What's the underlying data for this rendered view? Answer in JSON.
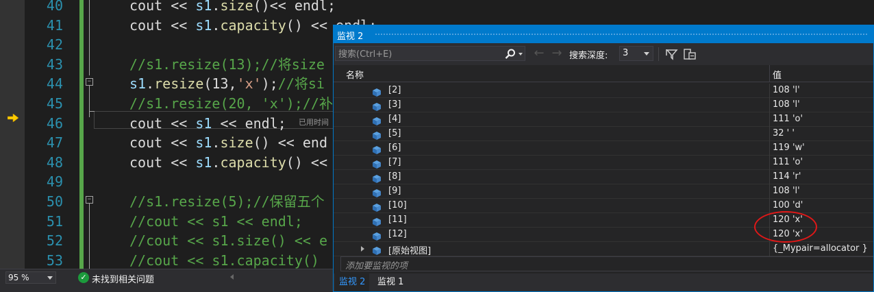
{
  "editor": {
    "lines": [
      {
        "num": "40",
        "segments": [
          {
            "t": "cout << ",
            "c": "p"
          },
          {
            "t": "s1",
            "c": "id"
          },
          {
            "t": ".",
            "c": "p"
          },
          {
            "t": "size",
            "c": "fn"
          },
          {
            "t": "()<< endl;",
            "c": "p"
          }
        ]
      },
      {
        "num": "41",
        "segments": [
          {
            "t": "cout << ",
            "c": "p"
          },
          {
            "t": "s1",
            "c": "id"
          },
          {
            "t": ".",
            "c": "p"
          },
          {
            "t": "capacity",
            "c": "fn"
          },
          {
            "t": "() << endl;",
            "c": "p"
          }
        ]
      },
      {
        "num": "42",
        "segments": []
      },
      {
        "num": "43",
        "segments": [
          {
            "t": "//s1.resize(13);//将size",
            "c": "cm"
          }
        ]
      },
      {
        "num": "44",
        "segments": [
          {
            "t": "s1",
            "c": "id"
          },
          {
            "t": ".",
            "c": "p"
          },
          {
            "t": "resize",
            "c": "fn"
          },
          {
            "t": "(13,",
            "c": "p"
          },
          {
            "t": "'x'",
            "c": "str"
          },
          {
            "t": ");",
            "c": "p"
          },
          {
            "t": "//将si",
            "c": "cm"
          }
        ]
      },
      {
        "num": "45",
        "segments": [
          {
            "t": "//s1.resize(20, 'x');//补",
            "c": "cm"
          }
        ]
      },
      {
        "num": "46",
        "segments": [
          {
            "t": "cout << ",
            "c": "p"
          },
          {
            "t": "s1",
            "c": "id"
          },
          {
            "t": " << endl;",
            "c": "p"
          }
        ]
      },
      {
        "num": "47",
        "segments": [
          {
            "t": "cout << ",
            "c": "p"
          },
          {
            "t": "s1",
            "c": "id"
          },
          {
            "t": ".",
            "c": "p"
          },
          {
            "t": "size",
            "c": "fn"
          },
          {
            "t": "() << end",
            "c": "p"
          }
        ]
      },
      {
        "num": "48",
        "segments": [
          {
            "t": "cout << ",
            "c": "p"
          },
          {
            "t": "s1",
            "c": "id"
          },
          {
            "t": ".",
            "c": "p"
          },
          {
            "t": "capacity",
            "c": "fn"
          },
          {
            "t": "() <<",
            "c": "p"
          }
        ]
      },
      {
        "num": "49",
        "segments": []
      },
      {
        "num": "50",
        "segments": [
          {
            "t": "//s1.resize(5);//保留五个",
            "c": "cm"
          }
        ]
      },
      {
        "num": "51",
        "segments": [
          {
            "t": "//cout << s1 << endl;",
            "c": "cm"
          }
        ]
      },
      {
        "num": "52",
        "segments": [
          {
            "t": "//cout << s1.size() << e",
            "c": "cm"
          }
        ]
      },
      {
        "num": "53",
        "segments": [
          {
            "t": "//cout << s1.capacity() ",
            "c": "cm"
          }
        ]
      }
    ],
    "elapsed_hint": "已用时间",
    "zoom": "95 %",
    "issues": "未找到相关问题"
  },
  "watch": {
    "title": "监视 2",
    "search_placeholder": "搜索(Ctrl+E)",
    "depth_label": "搜索深度:",
    "depth_value": "3",
    "col_name": "名称",
    "col_value": "值",
    "rows": [
      {
        "name": "[2]",
        "value": "108 'l'"
      },
      {
        "name": "[3]",
        "value": "108 'l'"
      },
      {
        "name": "[4]",
        "value": "111 'o'"
      },
      {
        "name": "[5]",
        "value": "32 ' '"
      },
      {
        "name": "[6]",
        "value": "119 'w'"
      },
      {
        "name": "[7]",
        "value": "111 'o'"
      },
      {
        "name": "[8]",
        "value": "114 'r'"
      },
      {
        "name": "[9]",
        "value": "108 'l'"
      },
      {
        "name": "[10]",
        "value": "100 'd'"
      },
      {
        "name": "[11]",
        "value": "120 'x'"
      },
      {
        "name": "[12]",
        "value": "120 'x'"
      }
    ],
    "raw_view": {
      "name": "[原始视图]",
      "value": "{_Mypair=allocator }"
    },
    "add_watch": "添加要监视的项",
    "tabs": [
      "监视 2",
      "监视 1"
    ]
  },
  "colors": {
    "accent": "#007acc",
    "highlight": "#e01818",
    "comment": "#57a64a"
  }
}
